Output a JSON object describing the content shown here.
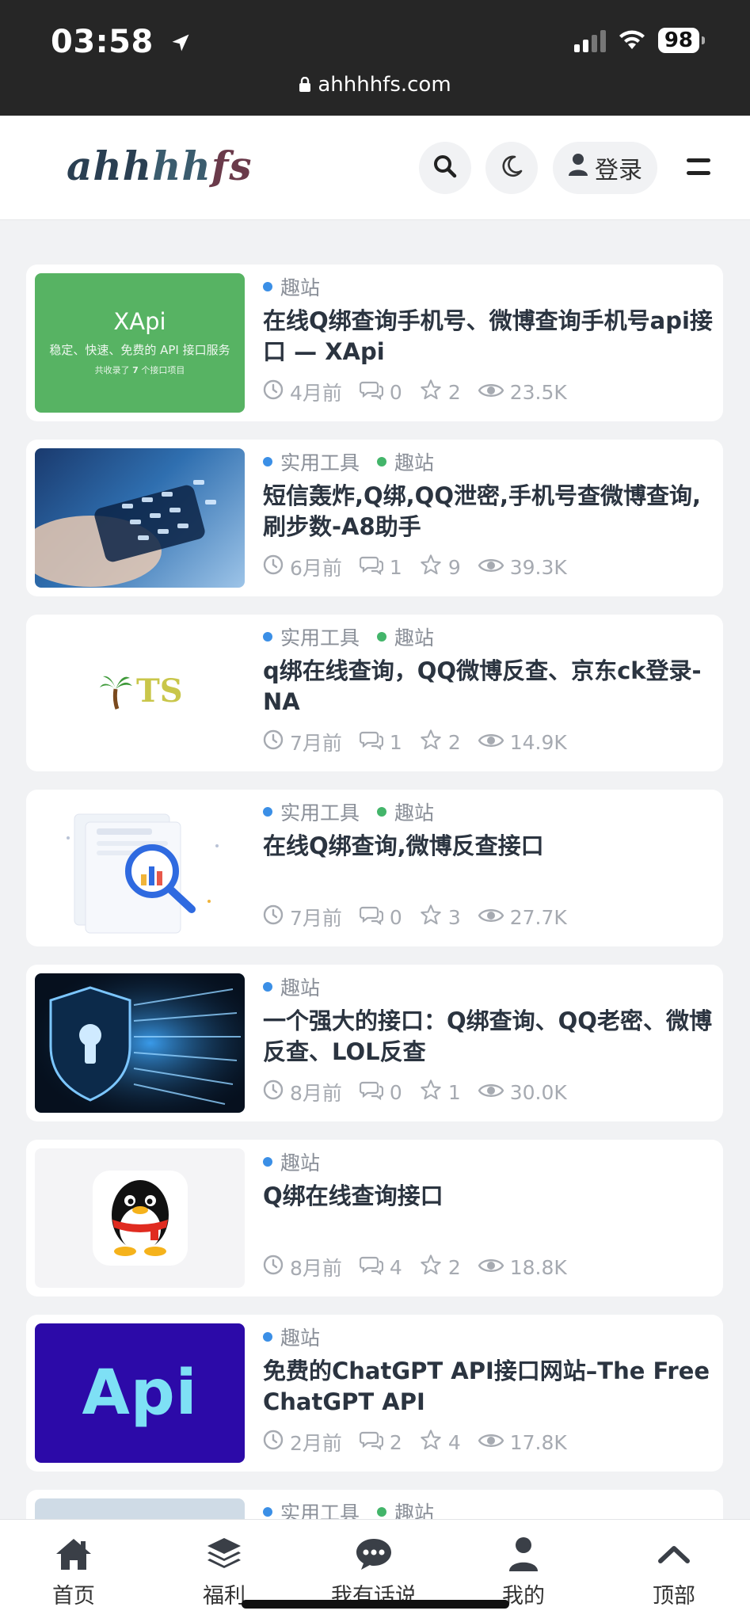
{
  "status": {
    "time": "03:58",
    "battery": "98",
    "url": "ahhhhfs.com"
  },
  "header": {
    "logo": "ahhhhfs",
    "login_label": "登录"
  },
  "posts": [
    {
      "cats": [
        {
          "label": "趣站",
          "color": "#3b8fe6"
        }
      ],
      "title": "在线Q绑查询手机号、微博查询手机号api接口 — XApi",
      "time": "4月前",
      "comments": "0",
      "stars": "2",
      "views": "23.5K",
      "thumb": "xapi"
    },
    {
      "cats": [
        {
          "label": "实用工具",
          "color": "#3b8fe6"
        },
        {
          "label": "趣站",
          "color": "#43b56a"
        }
      ],
      "title": "短信轰炸,Q绑,QQ泄密,手机号查微博查询,刷步数-A8助手",
      "time": "6月前",
      "comments": "1",
      "stars": "9",
      "views": "39.3K",
      "thumb": "phone"
    },
    {
      "cats": [
        {
          "label": "实用工具",
          "color": "#3b8fe6"
        },
        {
          "label": "趣站",
          "color": "#43b56a"
        }
      ],
      "title": "q绑在线查询，QQ微博反查、京东ck登录-NA",
      "time": "7月前",
      "comments": "1",
      "stars": "2",
      "views": "14.9K",
      "thumb": "ts"
    },
    {
      "cats": [
        {
          "label": "实用工具",
          "color": "#3b8fe6"
        },
        {
          "label": "趣站",
          "color": "#43b56a"
        }
      ],
      "title": "在线Q绑查询,微博反查接口",
      "time": "7月前",
      "comments": "0",
      "stars": "3",
      "views": "27.7K",
      "thumb": "magnifier"
    },
    {
      "cats": [
        {
          "label": "趣站",
          "color": "#3b8fe6"
        }
      ],
      "title": "一个强大的接口：Q绑查询、QQ老密、微博反查、LOL反查",
      "time": "8月前",
      "comments": "0",
      "stars": "1",
      "views": "30.0K",
      "thumb": "shield"
    },
    {
      "cats": [
        {
          "label": "趣站",
          "color": "#3b8fe6"
        }
      ],
      "title": "Q绑在线查询接口",
      "time": "8月前",
      "comments": "4",
      "stars": "2",
      "views": "18.8K",
      "thumb": "qq"
    },
    {
      "cats": [
        {
          "label": "趣站",
          "color": "#3b8fe6"
        }
      ],
      "title": "免费的ChatGPT API接口网站–The Free ChatGPT API",
      "time": "2月前",
      "comments": "2",
      "stars": "4",
      "views": "17.8K",
      "thumb": "api"
    },
    {
      "cats": [
        {
          "label": "实用工具",
          "color": "#3b8fe6"
        },
        {
          "label": "趣站",
          "color": "#43b56a"
        }
      ],
      "title": "",
      "time": "",
      "comments": "",
      "stars": "",
      "views": "",
      "thumb": "partial"
    }
  ],
  "thumbs": {
    "xapi": {
      "title": "XApi",
      "subtitle": "稳定、快速、免费的 API 接口服务",
      "note_pre": "共收录了",
      "note_num": "7",
      "note_post": "个接口项目"
    },
    "ts": {
      "text": "TS"
    },
    "api": {
      "text": "Api"
    }
  },
  "tabs": [
    {
      "label": "首页",
      "icon": "home-icon"
    },
    {
      "label": "福利",
      "icon": "layers-icon"
    },
    {
      "label": "我有话说",
      "icon": "chat-icon"
    },
    {
      "label": "我的",
      "icon": "user-icon"
    },
    {
      "label": "顶部",
      "icon": "chevron-up-icon"
    }
  ]
}
